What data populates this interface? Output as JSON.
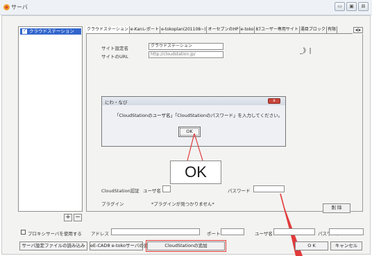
{
  "window": {
    "title": "サーバ"
  },
  "sidebar": {
    "items": [
      {
        "label": "クラウドステーション",
        "checked": true
      }
    ],
    "add_label": "+",
    "remove_label": "−"
  },
  "tabs": [
    "クラウドステーション",
    "e-Kanレポート",
    "e-tokoplan(201108~)",
    "オーセブンのHP",
    "e-toko",
    "87ユーザー専用サイト",
    "湯目ブロック",
    "有限"
  ],
  "tab_scroll_label": "◂|▸",
  "form": {
    "site_name_label": "サイト設定名",
    "site_name_value": "クラウドステーション",
    "site_url_label": "サイトのURL",
    "site_url_value": "http://cloudstation.jp/",
    "toggle_label": "_》|",
    "auth_label": "CloudStation認証",
    "user_label": "ユーザ名",
    "password_label": "パスワード",
    "plugin_label": "プラグイン",
    "plugin_value": "*プラグインが見つかりません*",
    "delete_label": "削 除"
  },
  "dialog": {
    "title": "にわ・なび",
    "message": "「CloudStationのユーザ名」「CloudStationのパスワード」を入力してください。",
    "ok_label": "OK",
    "close_label": "x"
  },
  "callout": {
    "text": "OK"
  },
  "proxy": {
    "use_label": "プロキシサーバを使用する",
    "address_label": "アドレス",
    "port_label": "ポート",
    "user_label": "ユーザ名",
    "password_label": "パスワード"
  },
  "footer": {
    "load_settings_label": "サーバ設定ファイルの読み込み",
    "ecad_label": "eE-CAD8 e-tokoサーバの追加",
    "cloudstation_label": "CloudStationの追加",
    "ok_label": "O K",
    "cancel_label": "キャンセル"
  },
  "colors": {
    "selection": "#3366cc",
    "annotation_red": "#e23a3a",
    "dialog_close": "#c9453a"
  }
}
